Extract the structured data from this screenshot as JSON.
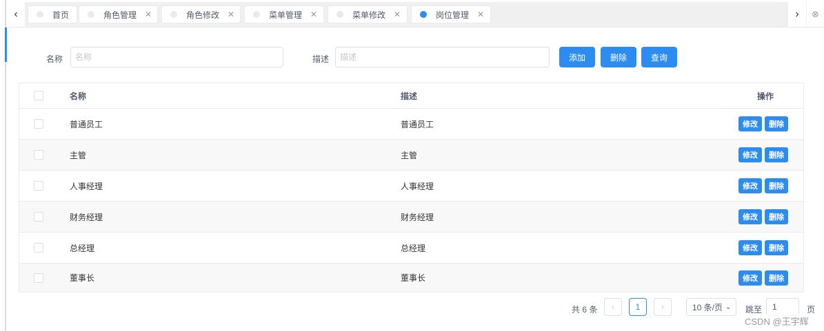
{
  "tabs": [
    {
      "label": "首页",
      "closable": false,
      "active": false
    },
    {
      "label": "角色管理",
      "closable": true,
      "active": false
    },
    {
      "label": "角色修改",
      "closable": true,
      "active": false
    },
    {
      "label": "菜单管理",
      "closable": true,
      "active": false
    },
    {
      "label": "菜单修改",
      "closable": true,
      "active": false
    },
    {
      "label": "岗位管理",
      "closable": true,
      "active": true
    }
  ],
  "search": {
    "name_label": "名称",
    "name_placeholder": "名称",
    "desc_label": "描述",
    "desc_placeholder": "描述",
    "add_label": "添加",
    "delete_label": "删除",
    "query_label": "查询"
  },
  "table": {
    "columns": [
      "名称",
      "描述",
      "操作"
    ],
    "rows": [
      {
        "name": "普通员工",
        "desc": "普通员工"
      },
      {
        "name": "主管",
        "desc": "主管"
      },
      {
        "name": "人事经理",
        "desc": "人事经理"
      },
      {
        "name": "财务经理",
        "desc": "财务经理"
      },
      {
        "name": "总经理",
        "desc": "总经理"
      },
      {
        "name": "董事长",
        "desc": "董事长"
      }
    ],
    "edit_label": "修改",
    "remove_label": "删除"
  },
  "pagination": {
    "total_text": "共 6 条",
    "current_page": "1",
    "page_size": "10 条/页",
    "jump_label": "跳至",
    "jump_value": "1",
    "page_suffix": "页"
  },
  "watermark": "CSDN @王宇辉",
  "colors": {
    "primary": "#2d8cf0",
    "border": "#dcdee2",
    "stripe": "#f8f8f9"
  }
}
